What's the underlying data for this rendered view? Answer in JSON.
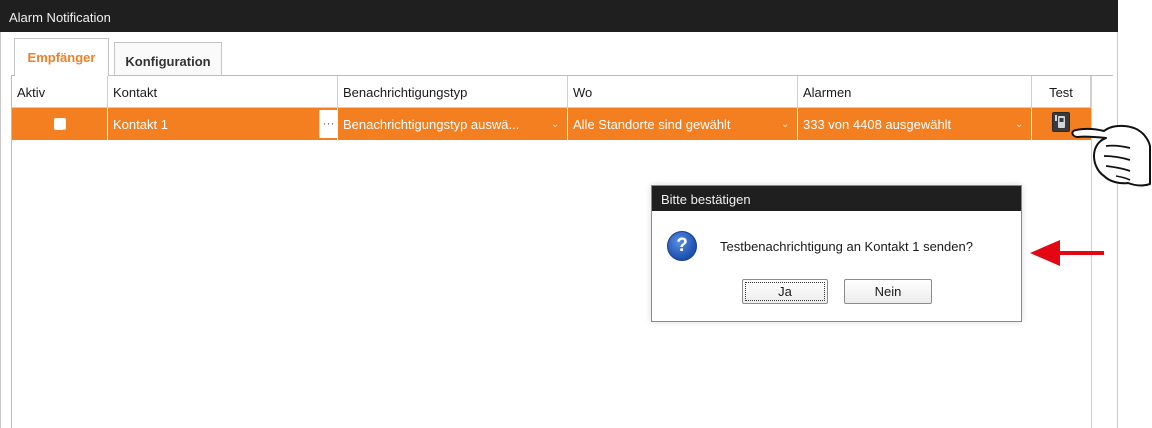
{
  "window": {
    "title": "Alarm Notification"
  },
  "tabs": [
    {
      "label": "Empfänger",
      "active": true
    },
    {
      "label": "Konfiguration",
      "active": false
    }
  ],
  "grid": {
    "columns": [
      "Aktiv",
      "Kontakt",
      "Benachrichtigungstyp",
      "Wo",
      "Alarmen",
      "Test"
    ],
    "rows": [
      {
        "aktiv": true,
        "kontakt": "Kontakt 1",
        "dots": "···",
        "typ": "Benachrichtigungstyp auswä...",
        "wo": "Alle Standorte sind gewählt",
        "alarmen": "333 von 4408 ausgewählt"
      }
    ]
  },
  "dialog": {
    "title": "Bitte bestätigen",
    "message": "Testbenachrichtigung an Kontakt 1 senden?",
    "icon": "?",
    "yes_label": "Ja",
    "no_label": "Nein"
  },
  "colors": {
    "accent_orange": "#f47f20",
    "titlebar": "#1f1f1f",
    "arrow_red": "#e30613"
  },
  "icons": [
    "checkbox-checked-icon",
    "test-phone-icon",
    "question-icon",
    "pointing-hand-icon",
    "red-arrow-icon",
    "chevron-down-icon"
  ]
}
